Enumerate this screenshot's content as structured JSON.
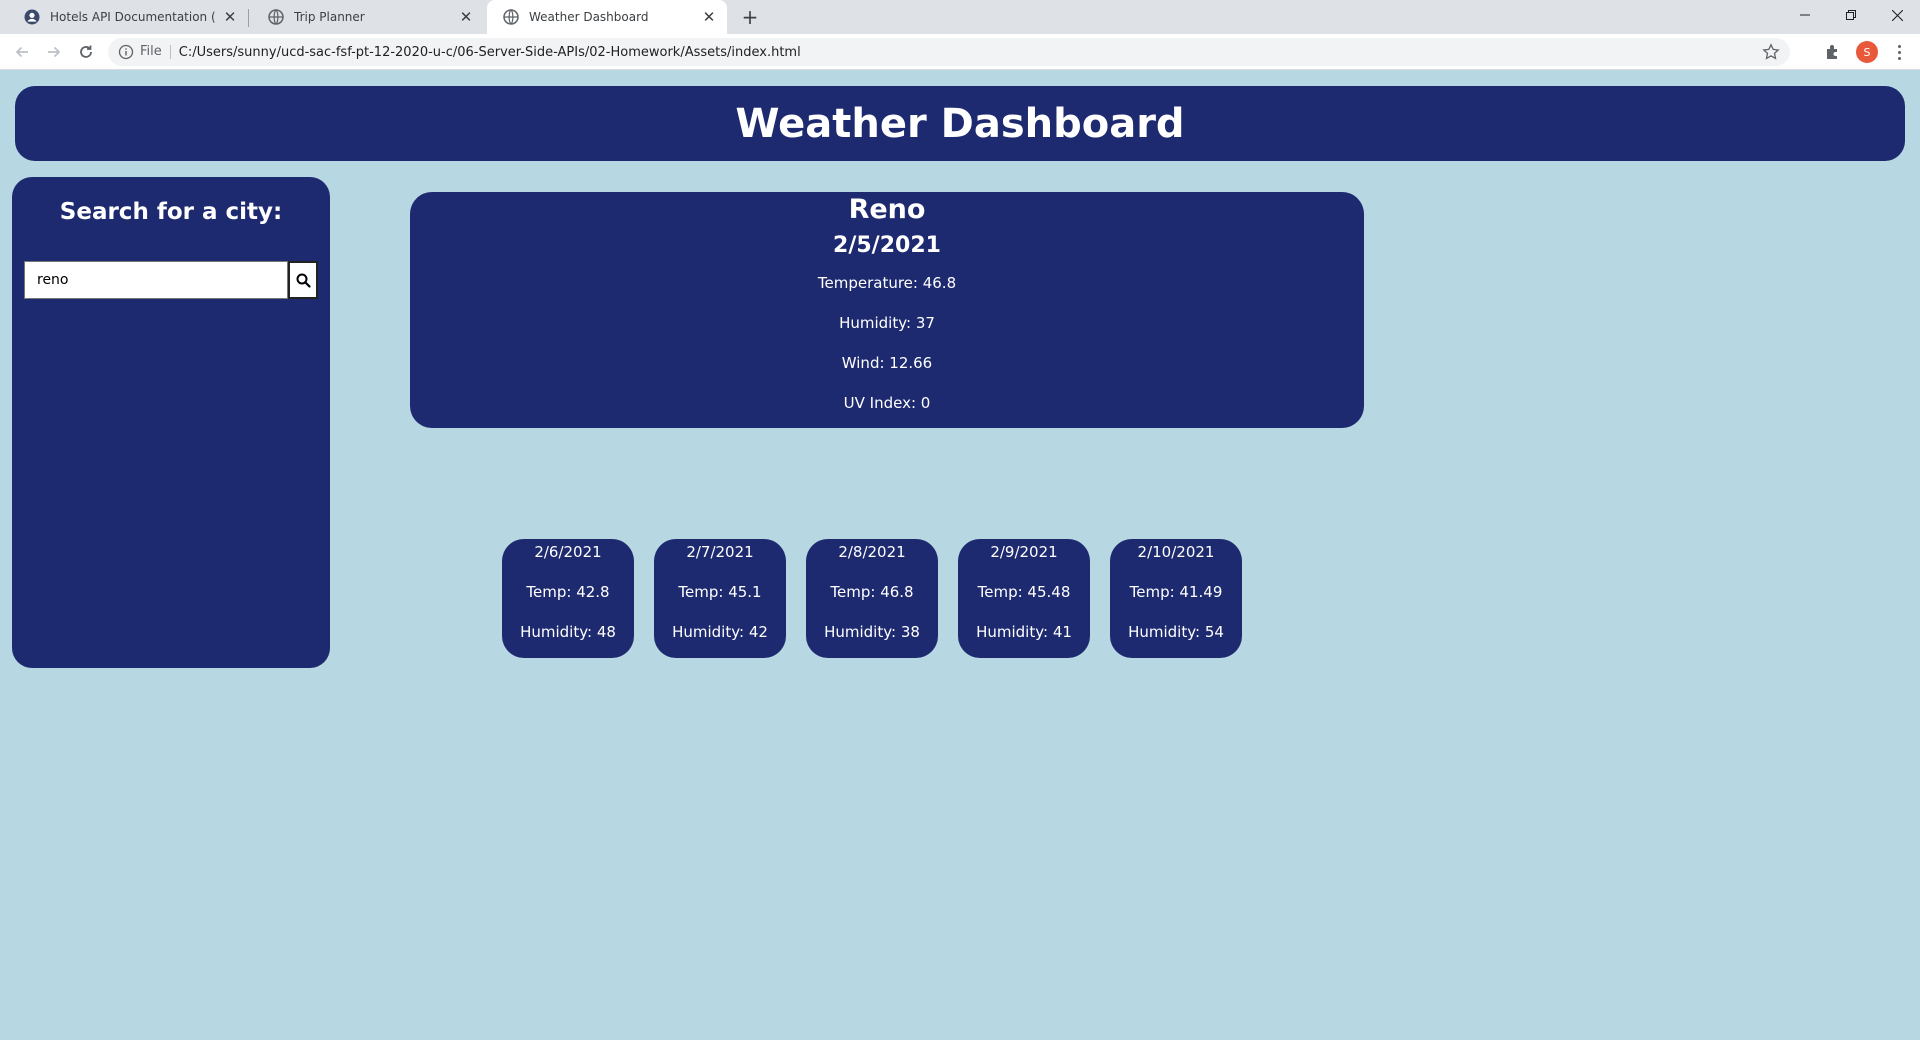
{
  "browser": {
    "tabs": [
      {
        "title": "Hotels API Documentation (apidojo)",
        "icon": "user-circle-icon"
      },
      {
        "title": "Trip Planner",
        "icon": "globe-icon"
      },
      {
        "title": "Weather Dashboard",
        "icon": "globe-icon",
        "active": true
      }
    ],
    "scheme": "File",
    "url": "C:/Users/sunny/ucd-sac-fsf-pt-12-2020-u-c/06-Server-Side-APIs/02-Homework/Assets/index.html",
    "profile_initial": "S"
  },
  "header": {
    "title": "Weather Dashboard"
  },
  "sidebar": {
    "heading": "Search for a city:",
    "search_value": "reno",
    "search_icon": "search-icon"
  },
  "current": {
    "city": "Reno",
    "date": "2/5/2021",
    "temperature": "Temperature: 46.8",
    "humidity": "Humidity: 37",
    "wind": "Wind: 12.66",
    "uv": "UV Index: 0"
  },
  "forecast": [
    {
      "date": "2/6/2021",
      "temp": "Temp: 42.8",
      "humidity": "Humidity: 48"
    },
    {
      "date": "2/7/2021",
      "temp": "Temp: 45.1",
      "humidity": "Humidity: 42"
    },
    {
      "date": "2/8/2021",
      "temp": "Temp: 46.8",
      "humidity": "Humidity: 38"
    },
    {
      "date": "2/9/2021",
      "temp": "Temp: 45.48",
      "humidity": "Humidity: 41"
    },
    {
      "date": "2/10/2021",
      "temp": "Temp: 41.49",
      "humidity": "Humidity: 54"
    }
  ],
  "colors": {
    "page_bg": "#b7d7e3",
    "panel_bg": "#1e2a6f",
    "text": "#ffffff"
  }
}
